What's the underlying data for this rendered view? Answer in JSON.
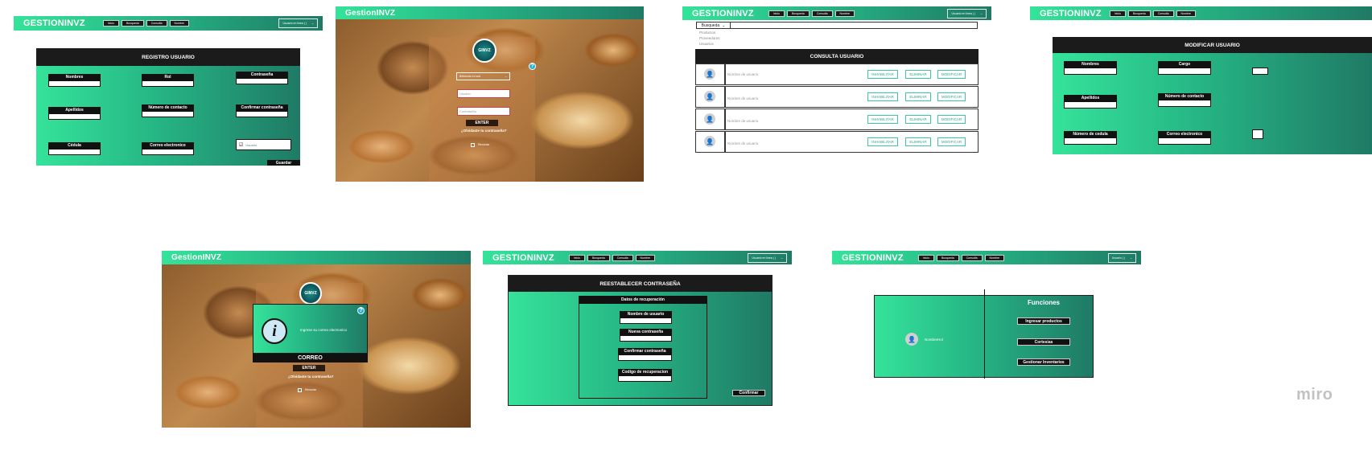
{
  "common": {
    "brand": "GESTIONINVZ",
    "brand_alt": "GestionINVZ",
    "nav": [
      "Inicio",
      "Busqueda",
      "Consulta",
      "Nombre"
    ],
    "user_box": "Usuario en linea ( )",
    "user_box_short": "Usuario ( )",
    "watermark": "miro"
  },
  "registro": {
    "title": "REGISTRO USUARIO",
    "fields": [
      "Nombres",
      "Rol",
      "Contraseña",
      "Apellidos",
      "Número de contacto",
      "Confirmar contraseña",
      "Cédula",
      "Correo electronico"
    ],
    "checkbox_label": "Usuario",
    "save_button": "Guardar"
  },
  "login": {
    "logo_text": "GINVZ",
    "select_label": "Bebiendo en sub",
    "user_placeholder": "Usuario",
    "pass_placeholder": "Contraseña",
    "enter": "ENTER",
    "forgot": "¿Olvidaste tu contraseña?",
    "remember": "Recordar",
    "help": "?"
  },
  "consulta": {
    "dropdown": "Busqueda",
    "menu": [
      "Productos",
      "Proveedores",
      "Usuarios"
    ],
    "title": "CONSULTA USUARIO",
    "rows": [
      {
        "name": "Nombre de usuario"
      },
      {
        "name": "Nombre de usuario"
      },
      {
        "name": "Nombre de usuario"
      },
      {
        "name": "Nombre de usuario"
      }
    ],
    "btn_disable": "INHABILITAR",
    "btn_delete": "ELIMINAR",
    "btn_modify": "MODIFICAR"
  },
  "modificar": {
    "title": "MODIFICAR USUARIO",
    "fields": [
      "Nombres",
      "Cargo",
      "Apellidos",
      "Número de contacto",
      "Número de cedula",
      "Correo electronico"
    ]
  },
  "recover": {
    "info_text": "Ingrese su correo electronico",
    "correo": "CORREO",
    "enter": "ENTER",
    "forgot": "¿Olvidaste tu contraseña?",
    "remember": "Recordar",
    "help": "?"
  },
  "reset": {
    "title": "REESTABLECER CONTRASEÑA",
    "subtitle": "Datos de recuperación",
    "fields": [
      "Nombre de usuario",
      "Nueva contraseña",
      "Confirmar contraseña",
      "Codigo de recuperacion"
    ],
    "confirm": "Confirmar"
  },
  "funciones": {
    "title": "Funciones",
    "user_name": "NombreHol",
    "buttons": [
      "Ingresar productos",
      "Cortesias",
      "Gestionar Inventarios"
    ]
  }
}
